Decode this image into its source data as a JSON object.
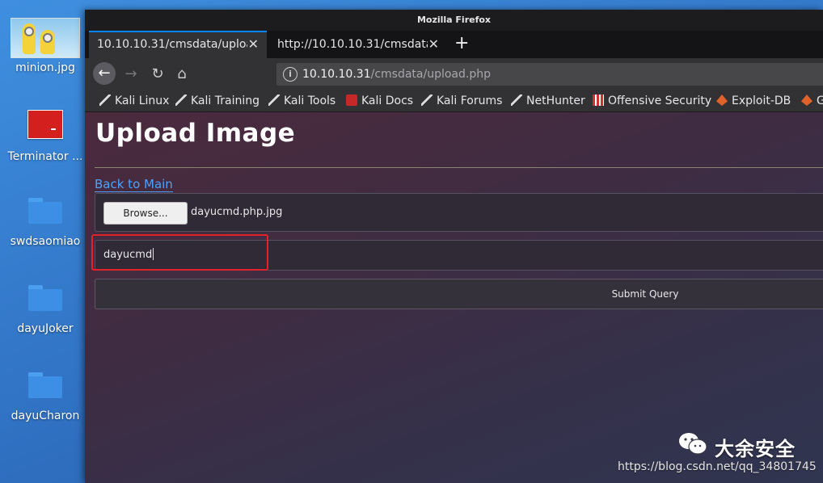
{
  "desktop": {
    "icons": [
      {
        "label": "minion.jpg"
      },
      {
        "label": "Terminator ..."
      },
      {
        "label": "swdsaomiao"
      },
      {
        "label": "dayuJoker"
      },
      {
        "label": "dayuCharon"
      }
    ]
  },
  "window": {
    "title": "Mozilla Firefox",
    "tabs": [
      {
        "label": "10.10.10.31/cmsdata/upload",
        "active": true
      },
      {
        "label": "http://10.10.10.31/cmsdata/u",
        "active": false
      }
    ],
    "new_tab": "+",
    "url": {
      "host": "10.10.10.31",
      "path": "/cmsdata/upload.php"
    },
    "bookmarks": [
      "Kali Linux",
      "Kali Training",
      "Kali Tools",
      "Kali Docs",
      "Kali Forums",
      "NetHunter",
      "Offensive Security",
      "Exploit-DB",
      "G"
    ]
  },
  "page": {
    "title": "Upload Image",
    "back_link": "Back to Main",
    "browse_label": "Browse...",
    "file_name": "dayucmd.php.jpg",
    "text_value": "dayucmd",
    "submit_label": "Submit Query"
  },
  "watermark": {
    "text": "大余安全",
    "url": "https://blog.csdn.net/qq_34801745"
  },
  "colors": {
    "accent": "#0a84ff",
    "highlight": "#e0222a",
    "link": "#4aa3ff"
  }
}
